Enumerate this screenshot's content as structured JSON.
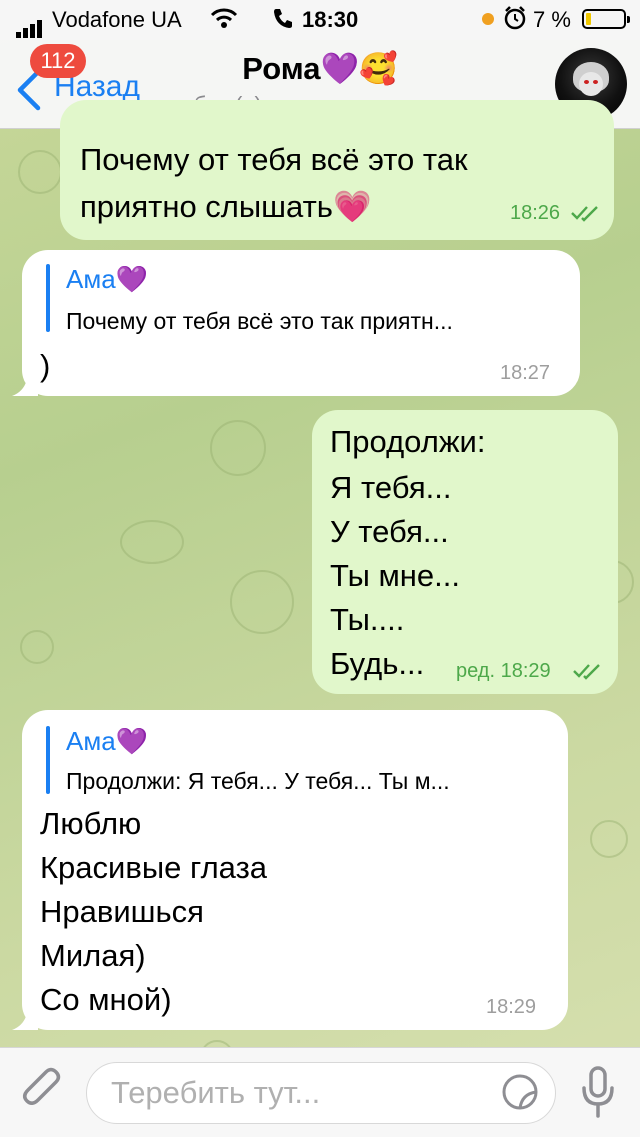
{
  "status_bar": {
    "carrier": "Vodafone UA",
    "time": "18:30",
    "battery_percent": "7 %",
    "battery_level": 0.07
  },
  "header": {
    "back_label": "Назад",
    "unread_badge": "112",
    "title": "Рома💜🥰",
    "subtitle": "был(а) на хуе только что"
  },
  "messages": [
    {
      "direction": "out",
      "lines": [
        "Почему от тебя всё это так",
        "приятно слышать💗"
      ],
      "time": "18:26",
      "read": true
    },
    {
      "direction": "in",
      "reply": {
        "name": "Ама💜",
        "text": "Почему от тебя всё это так приятн..."
      },
      "lines": [
        ")"
      ],
      "time": "18:27"
    },
    {
      "direction": "out",
      "lines": [
        "Продолжи:",
        "Я тебя...",
        "У тебя...",
        "Ты мне...",
        "Ты....",
        "Будь..."
      ],
      "time": "ред. 18:29",
      "read": true
    },
    {
      "direction": "in",
      "reply": {
        "name": "Ама💜",
        "text": "Продолжи: Я тебя... У тебя... Ты м..."
      },
      "lines": [
        "Люблю",
        "Красивые глаза",
        "Нравишься",
        "Милая)",
        "Со мной)"
      ],
      "time": "18:29"
    }
  ],
  "input": {
    "placeholder": "Теребить тут..."
  },
  "icons": {
    "back": "chevron-left-icon",
    "attach": "paperclip-icon",
    "sticker": "sticker-icon",
    "mic": "microphone-icon"
  },
  "colors": {
    "accent": "#1a7ff2",
    "outgoing_bubble": "#e1f7cb",
    "incoming_bubble": "#ffffff",
    "check_green": "#4da84a",
    "badge_red": "#ee4b3e"
  }
}
